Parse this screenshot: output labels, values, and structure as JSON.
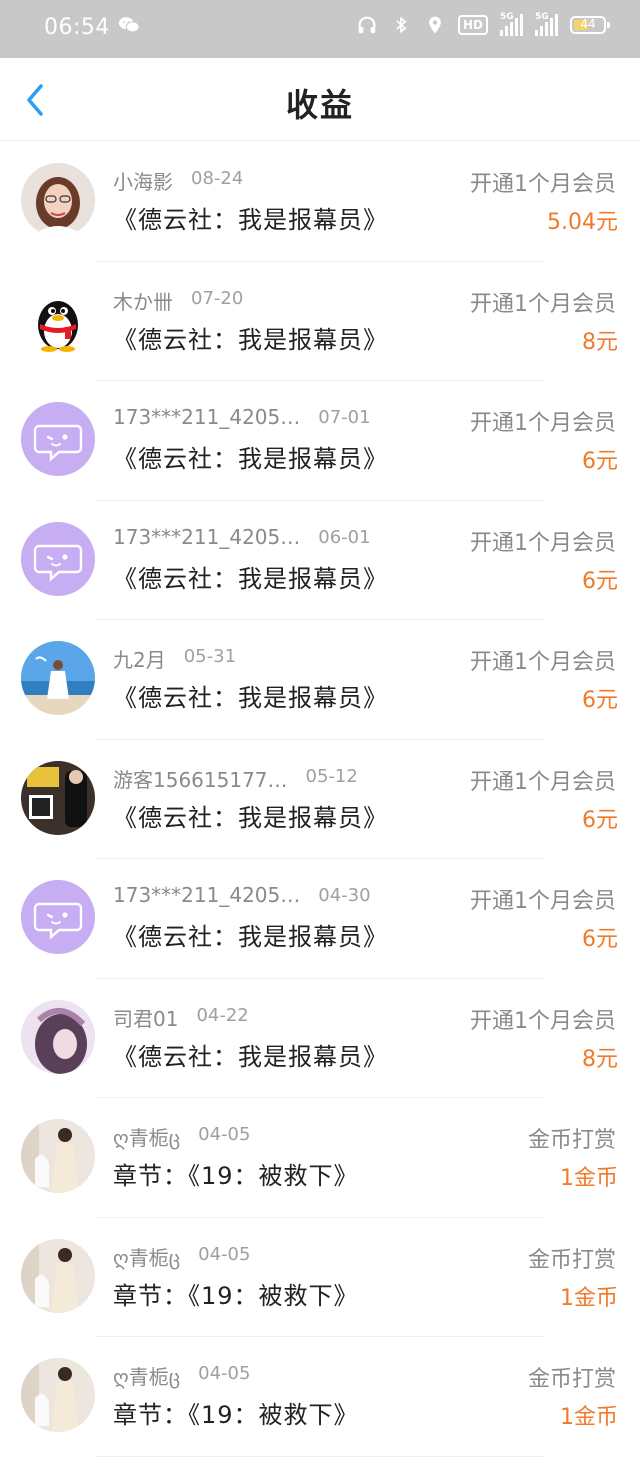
{
  "status_bar": {
    "time": "06:54",
    "battery": "44",
    "hd": "HD",
    "net1": "5G",
    "net2": "5G"
  },
  "header": {
    "title": "收益"
  },
  "colors": {
    "accent_blue": "#2a9df4",
    "amount_orange": "#f07a2a",
    "status_bar_bg": "#c8c8c8"
  },
  "earnings": [
    {
      "name": "小海影",
      "date": "08-24",
      "work": "《德云社：我是报幕员》",
      "type": "开通1个月会员",
      "amount": "5.04元",
      "avatar": "photo-girl"
    },
    {
      "name": "木か卌",
      "date": "07-20",
      "work": "《德云社：我是报幕员》",
      "type": "开通1个月会员",
      "amount": "8元",
      "avatar": "qq-penguin"
    },
    {
      "name": "173***211_4205…",
      "date": "07-01",
      "work": "《德云社：我是报幕员》",
      "type": "开通1个月会员",
      "amount": "6元",
      "avatar": "default-chat"
    },
    {
      "name": "173***211_4205…",
      "date": "06-01",
      "work": "《德云社：我是报幕员》",
      "type": "开通1个月会员",
      "amount": "6元",
      "avatar": "default-chat"
    },
    {
      "name": "九2月",
      "date": "05-31",
      "work": "《德云社：我是报幕员》",
      "type": "开通1个月会员",
      "amount": "6元",
      "avatar": "photo-beach"
    },
    {
      "name": "游客156615177…",
      "date": "05-12",
      "work": "《德云社：我是报幕员》",
      "type": "开通1个月会员",
      "amount": "6元",
      "avatar": "photo-dark"
    },
    {
      "name": "173***211_4205…",
      "date": "04-30",
      "work": "《德云社：我是报幕员》",
      "type": "开通1个月会员",
      "amount": "6元",
      "avatar": "default-chat"
    },
    {
      "name": "司君01",
      "date": "04-22",
      "work": "《德云社：我是报幕员》",
      "type": "开通1个月会员",
      "amount": "8元",
      "avatar": "photo-purple"
    },
    {
      "name": "ღ青栀ც",
      "date": "04-05",
      "work": "章节：《19：被救下》",
      "type": "金币打赏",
      "amount": "1金币",
      "avatar": "photo-dress"
    },
    {
      "name": "ღ青栀ც",
      "date": "04-05",
      "work": "章节：《19：被救下》",
      "type": "金币打赏",
      "amount": "1金币",
      "avatar": "photo-dress"
    },
    {
      "name": "ღ青栀ც",
      "date": "04-05",
      "work": "章节：《19：被救下》",
      "type": "金币打赏",
      "amount": "1金币",
      "avatar": "photo-dress"
    }
  ]
}
